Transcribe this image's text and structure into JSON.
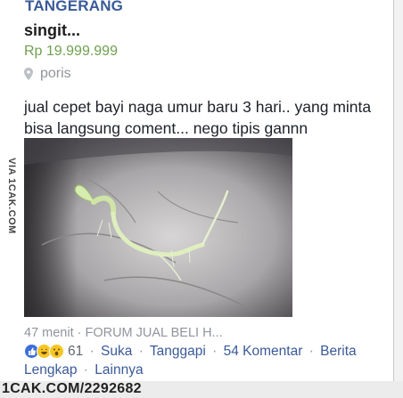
{
  "group": {
    "name": "TANGERANG"
  },
  "listing": {
    "title": "singit...",
    "price": "Rp 19.999.999",
    "location": "poris"
  },
  "post": {
    "text": "jual cepet bayi naga umur baru 3 hari.. yang minta\nbisa langsung coment... nego tipis gannn",
    "photo_icon": "photo-of-sprout-in-hand"
  },
  "watermark": {
    "vertical": "VIA 1CAK.COM",
    "bottom": "1CAK.COM/2292682"
  },
  "meta": {
    "time": "47 menit",
    "separator": "·",
    "group_name": "FORUM JUAL BELI H..."
  },
  "actions": {
    "reaction_icons": [
      "like-icon",
      "haha-icon",
      "wow-icon"
    ],
    "reaction_count": "61",
    "like": "Suka",
    "reply": "Tanggapi",
    "comments": "54 Komentar",
    "full_story": "Berita Lengkap",
    "more": "Lainnya"
  },
  "colors": {
    "group_blue": "#3a5a98",
    "price_green": "#6fa04f",
    "meta_gray": "#90949c",
    "like_blue": "#3b6fd8",
    "emoji_yellow": "#f7c623"
  }
}
